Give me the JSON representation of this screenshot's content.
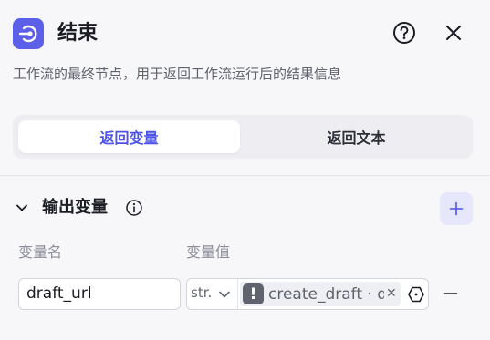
{
  "header": {
    "title": "结束",
    "description": "工作流的最终节点，用于返回工作流运行后的结果信息"
  },
  "segmented": {
    "tabs": [
      {
        "label": "返回变量",
        "active": true
      },
      {
        "label": "返回文本",
        "active": false
      }
    ]
  },
  "output": {
    "title": "输出变量",
    "col_name": "变量名",
    "col_value": "变量值",
    "rows": [
      {
        "name": "draft_url",
        "type": "str.",
        "reference": "create_draft · d"
      }
    ]
  },
  "colors": {
    "accent": "#4d53e8",
    "node_icon_bg": "#5c5fe8",
    "add_button_bg": "#e6e7fb"
  },
  "icons": {
    "node": "end-node-icon",
    "help": "help-icon",
    "close": "close-icon",
    "info": "info-icon",
    "add": "plus-icon",
    "remove": "minus-icon"
  }
}
